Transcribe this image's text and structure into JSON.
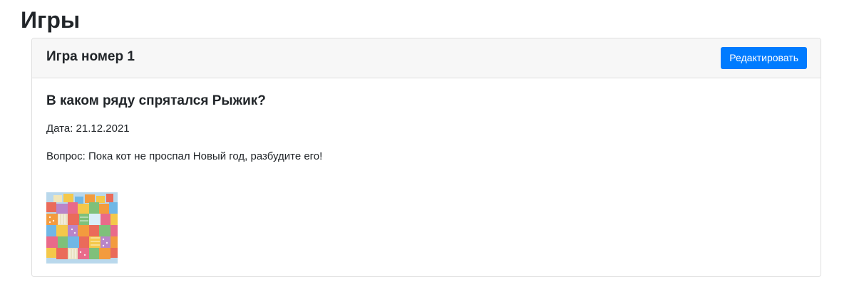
{
  "page": {
    "title": "Игры"
  },
  "game_card": {
    "header_title": "Игра номер 1",
    "edit_label": "Редактировать",
    "title": "В каком ряду спрятался Рыжик?",
    "date": "Дата: 21.12.2021",
    "question": "Вопрос: Пока кот не проспал Новый год, разбудите его!",
    "image_name": "gift-boxes-image"
  },
  "colors": {
    "accent": "#007bff",
    "header_bg": "#f7f7f7",
    "border": "#dfdfdf",
    "text": "#212529"
  }
}
